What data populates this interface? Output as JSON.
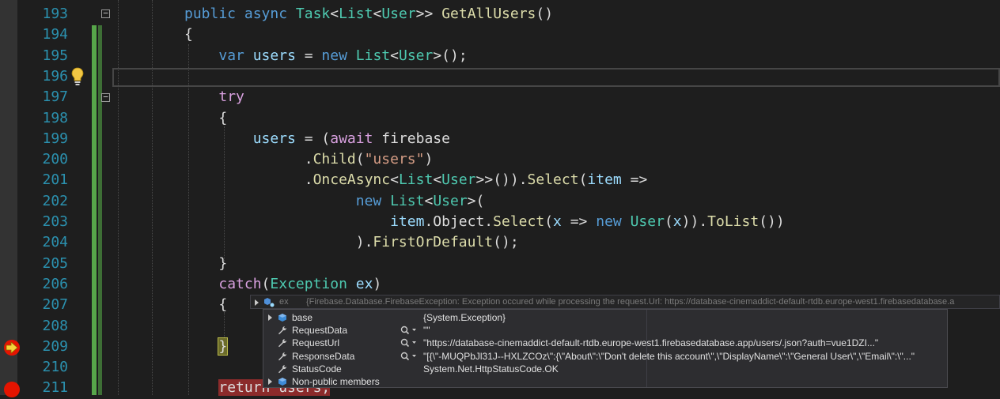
{
  "editor": {
    "lines": [
      {
        "n": "193",
        "tokens": [
          {
            "t": "public",
            "c": "kw"
          },
          {
            "t": " ",
            "c": "pl"
          },
          {
            "t": "async",
            "c": "kw"
          },
          {
            "t": " ",
            "c": "pl"
          },
          {
            "t": "Task",
            "c": "ty"
          },
          {
            "t": "<",
            "c": "pl"
          },
          {
            "t": "List",
            "c": "ty"
          },
          {
            "t": "<",
            "c": "pl"
          },
          {
            "t": "User",
            "c": "ty"
          },
          {
            "t": ">> ",
            "c": "pl"
          },
          {
            "t": "GetAllUsers",
            "c": "fn"
          },
          {
            "t": "()",
            "c": "pl"
          }
        ]
      },
      {
        "n": "194",
        "tokens": [
          {
            "t": "{",
            "c": "pl"
          }
        ]
      },
      {
        "n": "195",
        "tokens": [
          {
            "t": "    ",
            "c": "pl"
          },
          {
            "t": "var",
            "c": "kw"
          },
          {
            "t": " ",
            "c": "pl"
          },
          {
            "t": "users",
            "c": "var"
          },
          {
            "t": " = ",
            "c": "pl"
          },
          {
            "t": "new",
            "c": "kw"
          },
          {
            "t": " ",
            "c": "pl"
          },
          {
            "t": "List",
            "c": "ty"
          },
          {
            "t": "<",
            "c": "pl"
          },
          {
            "t": "User",
            "c": "ty"
          },
          {
            "t": ">();",
            "c": "pl"
          }
        ]
      },
      {
        "n": "196",
        "tokens": []
      },
      {
        "n": "197",
        "tokens": [
          {
            "t": "    ",
            "c": "pl"
          },
          {
            "t": "try",
            "c": "ctl"
          }
        ]
      },
      {
        "n": "198",
        "tokens": [
          {
            "t": "    {",
            "c": "pl"
          }
        ]
      },
      {
        "n": "199",
        "tokens": [
          {
            "t": "        ",
            "c": "pl"
          },
          {
            "t": "users",
            "c": "var"
          },
          {
            "t": " = (",
            "c": "pl"
          },
          {
            "t": "await",
            "c": "ctl"
          },
          {
            "t": " firebase",
            "c": "pl"
          }
        ]
      },
      {
        "n": "200",
        "tokens": [
          {
            "t": "              .",
            "c": "pl"
          },
          {
            "t": "Child",
            "c": "fn"
          },
          {
            "t": "(",
            "c": "pl"
          },
          {
            "t": "\"users\"",
            "c": "str"
          },
          {
            "t": ")",
            "c": "pl"
          }
        ]
      },
      {
        "n": "201",
        "tokens": [
          {
            "t": "              .",
            "c": "pl"
          },
          {
            "t": "OnceAsync",
            "c": "fn"
          },
          {
            "t": "<",
            "c": "pl"
          },
          {
            "t": "List",
            "c": "ty"
          },
          {
            "t": "<",
            "c": "pl"
          },
          {
            "t": "User",
            "c": "ty"
          },
          {
            "t": ">>()).",
            "c": "pl"
          },
          {
            "t": "Select",
            "c": "fn"
          },
          {
            "t": "(",
            "c": "pl"
          },
          {
            "t": "item",
            "c": "var"
          },
          {
            "t": " =>",
            "c": "pl"
          }
        ]
      },
      {
        "n": "202",
        "tokens": [
          {
            "t": "                    ",
            "c": "pl"
          },
          {
            "t": "new",
            "c": "kw"
          },
          {
            "t": " ",
            "c": "pl"
          },
          {
            "t": "List",
            "c": "ty"
          },
          {
            "t": "<",
            "c": "pl"
          },
          {
            "t": "User",
            "c": "ty"
          },
          {
            "t": ">(",
            "c": "pl"
          }
        ]
      },
      {
        "n": "203",
        "tokens": [
          {
            "t": "                        ",
            "c": "pl"
          },
          {
            "t": "item",
            "c": "var"
          },
          {
            "t": ".Object.",
            "c": "pl"
          },
          {
            "t": "Select",
            "c": "fn"
          },
          {
            "t": "(",
            "c": "pl"
          },
          {
            "t": "x",
            "c": "var"
          },
          {
            "t": " => ",
            "c": "pl"
          },
          {
            "t": "new",
            "c": "kw"
          },
          {
            "t": " ",
            "c": "pl"
          },
          {
            "t": "User",
            "c": "ty"
          },
          {
            "t": "(",
            "c": "pl"
          },
          {
            "t": "x",
            "c": "var"
          },
          {
            "t": ")).",
            "c": "pl"
          },
          {
            "t": "ToList",
            "c": "fn"
          },
          {
            "t": "())",
            "c": "pl"
          }
        ]
      },
      {
        "n": "204",
        "tokens": [
          {
            "t": "                    ).",
            "c": "pl"
          },
          {
            "t": "FirstOrDefault",
            "c": "fn"
          },
          {
            "t": "();",
            "c": "pl"
          }
        ]
      },
      {
        "n": "205",
        "tokens": [
          {
            "t": "    }",
            "c": "pl"
          }
        ]
      },
      {
        "n": "206",
        "tokens": [
          {
            "t": "    ",
            "c": "pl"
          },
          {
            "t": "catch",
            "c": "ctl"
          },
          {
            "t": "(",
            "c": "pl"
          },
          {
            "t": "Exception",
            "c": "ty"
          },
          {
            "t": " ",
            "c": "pl"
          },
          {
            "t": "ex",
            "c": "var"
          },
          {
            "t": ")",
            "c": "pl"
          }
        ]
      },
      {
        "n": "207",
        "tokens": [
          {
            "t": "    {",
            "c": "pl"
          }
        ]
      },
      {
        "n": "208",
        "tokens": []
      },
      {
        "n": "209",
        "tokens": [
          {
            "t": "    ",
            "c": "pl"
          },
          {
            "t": "}",
            "c": "exec"
          }
        ]
      },
      {
        "n": "210",
        "tokens": []
      },
      {
        "n": "211",
        "tokens": [
          {
            "t": "    ",
            "c": "pl"
          },
          {
            "t": "return users;",
            "c": "ret"
          }
        ]
      }
    ]
  },
  "datatip": {
    "header_name": "ex",
    "header_value": "{Firebase.Database.FirebaseException: Exception occured while processing the request.Url: https://database-cinemaddict-default-rtdb.europe-west1.firebasedatabase.a",
    "rows": [
      {
        "name": "base",
        "value": "{System.Exception}",
        "expandable": true,
        "icon": "field-icon",
        "magnifier": false
      },
      {
        "name": "RequestData",
        "value": "\"\"",
        "expandable": false,
        "icon": "wrench-icon",
        "magnifier": true
      },
      {
        "name": "RequestUrl",
        "value": "\"https://database-cinemaddict-default-rtdb.europe-west1.firebasedatabase.app/users/.json?auth=vue1DZI...\"",
        "expandable": false,
        "icon": "wrench-icon",
        "magnifier": true
      },
      {
        "name": "ResponseData",
        "value": "\"[{\\\"-MUQPbJl31J--HXLZCOz\\\":{\\\"About\\\":\\\"Don't delete this account\\\",\\\"DisplayName\\\":\\\"General User\\\",\\\"Email\\\":\\\"...\"",
        "expandable": false,
        "icon": "wrench-icon",
        "magnifier": true
      },
      {
        "name": "StatusCode",
        "value": "System.Net.HttpStatusCode.OK",
        "expandable": false,
        "icon": "wrench-icon",
        "magnifier": false
      },
      {
        "name": "Non-public members",
        "value": "",
        "expandable": true,
        "icon": "field-icon",
        "magnifier": false
      }
    ]
  },
  "colors": {
    "background": "#1e1e1e",
    "line_number": "#2b91af",
    "keyword": "#569cd6",
    "control": "#d8a0df",
    "type": "#4ec9b0",
    "method": "#dcdcaa",
    "string": "#d69d85",
    "variable": "#9cdcfe",
    "breakpoint": "#e51400",
    "change_bar": "#57a64a"
  }
}
